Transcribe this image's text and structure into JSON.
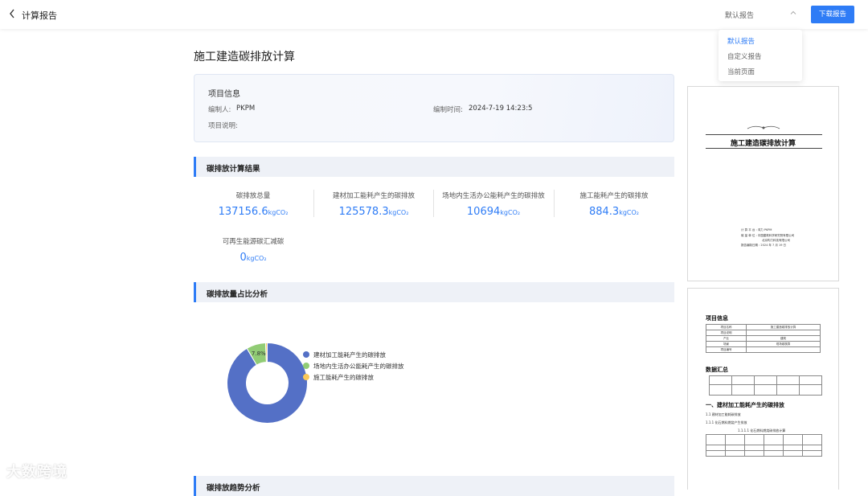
{
  "header": {
    "back_icon": "chevron-left-icon",
    "title": "计算报告",
    "template_selected": "默认报告",
    "download_label": "下载报告"
  },
  "dropdown": {
    "items": [
      "默认报告",
      "自定义报告",
      "当前页面"
    ],
    "active_index": 0
  },
  "report": {
    "title": "施工建造碳排放计算",
    "project": {
      "heading": "项目信息",
      "editor_label": "编制人:",
      "editor_value": "PKPM",
      "time_label": "编制时间:",
      "time_value": "2024-7-19 14:23:5",
      "desc_label": "项目说明:"
    },
    "results": {
      "heading": "碳排放计算结果",
      "unit": "kgCO₂",
      "metrics": [
        {
          "label": "碳排放总量",
          "value": "137156.6"
        },
        {
          "label": "建材加工能耗产生的碳排放",
          "value": "125578.3"
        },
        {
          "label": "场地内生活办公能耗产生的碳排放",
          "value": "10694"
        },
        {
          "label": "施工能耗产生的碳排放",
          "value": "884.3"
        },
        {
          "label": "可再生能源碳汇减碳",
          "value": "0"
        }
      ]
    },
    "share": {
      "heading": "碳排放量占比分析"
    },
    "trend": {
      "heading": "碳排放趋势分析"
    }
  },
  "chart_data": {
    "type": "pie",
    "categories": [
      "建材加工能耗产生的碳排放",
      "场地内生活办公能耗产生的碳排放",
      "施工能耗产生的碳排放"
    ],
    "values": [
      91.56,
      7.8,
      0.64
    ],
    "data_labels": [
      "91.56%",
      "7.8%",
      ""
    ],
    "colors": [
      "#5470c6",
      "#91cc75",
      "#fac858"
    ],
    "donut": true,
    "legend_position": "right"
  },
  "preview": {
    "cover": {
      "title": "施工建造碳排放计算",
      "lines": [
        "计 算 平 台 : 鸿力 PKPM",
        "碳 量 单 位 : 中国建筑科学研究院有限公司",
        "北京构力科技有限公司",
        "报告编制日期 : 2024 年 7 月 19 日"
      ]
    },
    "page2": {
      "h_project": "项目信息",
      "table_rows": [
        [
          "项目名称",
          "施工建造碳排放计算"
        ],
        [
          "项目说明",
          ""
        ],
        [
          "产业",
          "建筑"
        ],
        [
          "场景",
          "现场碳核算"
        ],
        [
          "项目编号",
          ""
        ]
      ],
      "h_summary": "数据汇总",
      "h_section": "一、建材加工能耗产生的碳排放",
      "sub1": "1.1 建材加工能耗碳排放",
      "sub2": "1.1.1 化石燃料燃烧产生排放",
      "table_caption": "1.1.1.1 化石燃料燃烧碳排放计算"
    }
  },
  "watermark": "大数跨境"
}
